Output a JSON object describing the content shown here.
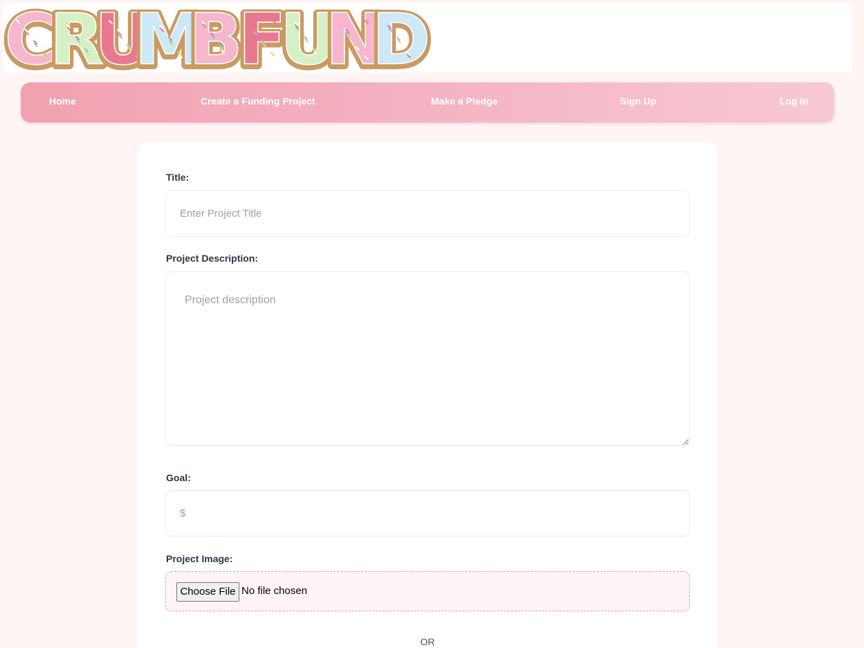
{
  "brand": {
    "logo_text": "CRUMBFUND",
    "letter_colors": [
      "#f6b6cd",
      "#d6f0c6",
      "#e8788e",
      "#cde8f6",
      "#f6b6cd",
      "#e8788e",
      "#d6f0c6",
      "#f6b6cd",
      "#cde8f6"
    ],
    "outline_color": "#c99a62"
  },
  "nav": {
    "items": [
      {
        "label": "Home"
      },
      {
        "label": "Create a Funding Project"
      },
      {
        "label": "Make a Pledge"
      },
      {
        "label": "Sign Up"
      },
      {
        "label": "Log In"
      }
    ]
  },
  "form": {
    "title_label": "Title:",
    "title_placeholder": "Enter Project Title",
    "description_label": "Project Description:",
    "description_placeholder": "Project description",
    "goal_label": "Goal:",
    "goal_placeholder": "$",
    "image_label": "Project Image:",
    "choose_file_label": "Choose File",
    "file_status": "No file chosen",
    "or_text": "OR"
  }
}
